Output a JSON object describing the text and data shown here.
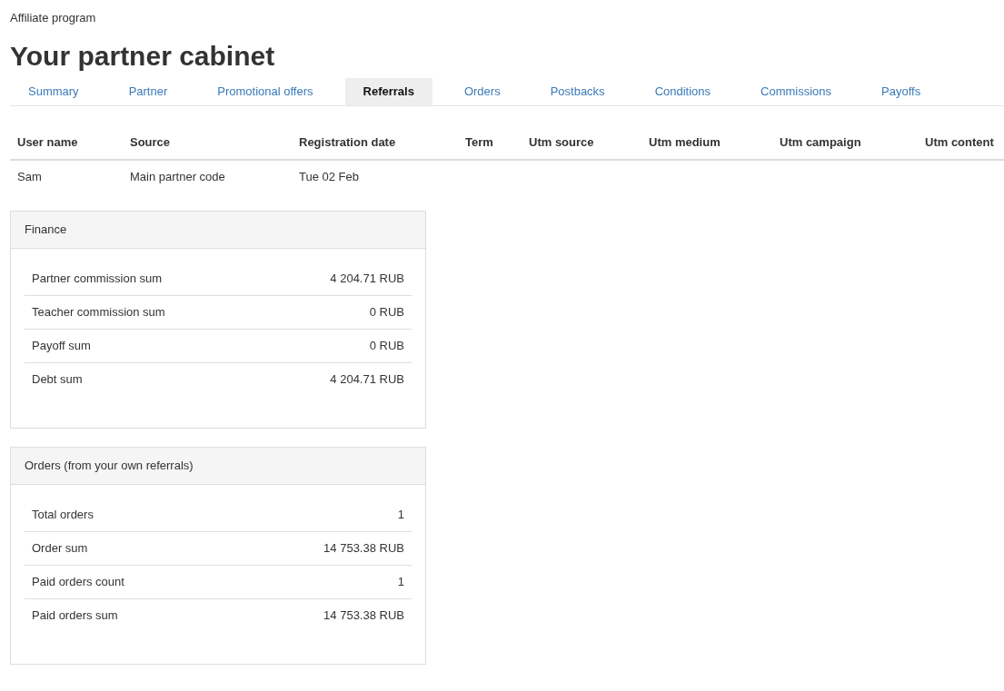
{
  "breadcrumb": "Affiliate program",
  "title": "Your partner cabinet",
  "tabs": [
    {
      "label": "Summary",
      "selected": false
    },
    {
      "label": "Partner",
      "selected": false
    },
    {
      "label": "Promotional offers",
      "selected": false
    },
    {
      "label": "Referrals",
      "selected": true
    },
    {
      "label": "Orders",
      "selected": false
    },
    {
      "label": "Postbacks",
      "selected": false
    },
    {
      "label": "Conditions",
      "selected": false
    },
    {
      "label": "Commissions",
      "selected": false
    },
    {
      "label": "Payoffs",
      "selected": false
    }
  ],
  "table": {
    "columns": [
      "User name",
      "Source",
      "Registration date",
      "Term",
      "Utm source",
      "Utm medium",
      "Utm campaign",
      "Utm content"
    ],
    "rows": [
      [
        "Sam",
        "Main partner code",
        "Tue 02 Feb"
      ]
    ]
  },
  "panels": [
    {
      "title": "Finance",
      "rows": [
        {
          "label": "Partner commission sum",
          "value": "4 204.71 RUB"
        },
        {
          "label": "Teacher commission sum",
          "value": "0 RUB"
        },
        {
          "label": "Payoff sum",
          "value": "0 RUB"
        },
        {
          "label": "Debt sum",
          "value": "4 204.71 RUB"
        }
      ]
    },
    {
      "title": "Orders (from your own referrals)",
      "rows": [
        {
          "label": "Total orders",
          "value": "1"
        },
        {
          "label": "Order sum",
          "value": "14 753.38 RUB"
        },
        {
          "label": "Paid orders count",
          "value": "1"
        },
        {
          "label": "Paid orders sum",
          "value": "14 753.38 RUB"
        }
      ]
    }
  ]
}
